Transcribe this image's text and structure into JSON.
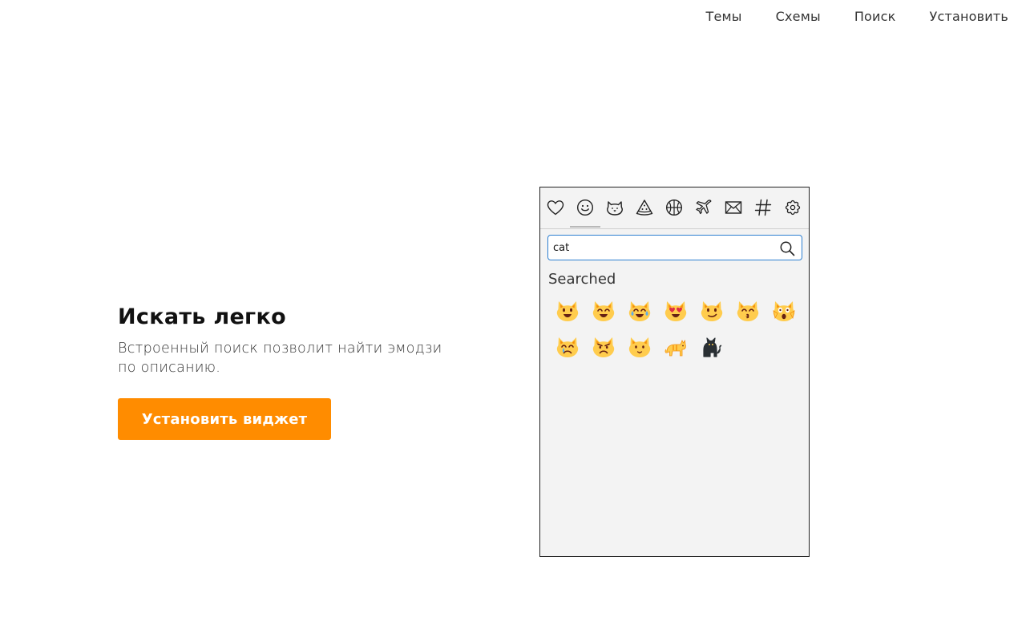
{
  "nav": {
    "items": [
      "Темы",
      "Схемы",
      "Поиск",
      "Установить"
    ]
  },
  "hero": {
    "title": "Искать легко",
    "description": "Встроенный поиск позволит найти эмодзи по описанию.",
    "cta_label": "Установить виджет"
  },
  "colors": {
    "accent": "#ff8c00",
    "search_border": "#2d7fd1",
    "widget_bg": "#f3f3f3"
  },
  "widget": {
    "categories": [
      {
        "icon": "heart-icon",
        "name": "favorites"
      },
      {
        "icon": "smiley-icon",
        "name": "smileys",
        "active": true
      },
      {
        "icon": "cat-face-icon",
        "name": "animals"
      },
      {
        "icon": "pizza-slice-icon",
        "name": "food"
      },
      {
        "icon": "ball-icon",
        "name": "activities"
      },
      {
        "icon": "airplane-icon",
        "name": "travel"
      },
      {
        "icon": "envelope-icon",
        "name": "objects"
      },
      {
        "icon": "hash-icon",
        "name": "symbols"
      },
      {
        "icon": "flower-icon",
        "name": "flags"
      }
    ],
    "search": {
      "value": "cat",
      "icon": "search-icon"
    },
    "section_label": "Searched",
    "results": [
      {
        "name": "grinning-cat-icon"
      },
      {
        "name": "grinning-cat-smiling-eyes-icon"
      },
      {
        "name": "cat-tears-of-joy-icon"
      },
      {
        "name": "smiling-cat-heart-eyes-icon"
      },
      {
        "name": "cat-wry-smile-icon"
      },
      {
        "name": "kissing-cat-icon"
      },
      {
        "name": "weary-cat-icon"
      },
      {
        "name": "crying-cat-icon"
      },
      {
        "name": "pouting-cat-icon"
      },
      {
        "name": "cat-face-icon"
      },
      {
        "name": "cat-icon"
      },
      {
        "name": "black-cat-icon"
      }
    ]
  }
}
